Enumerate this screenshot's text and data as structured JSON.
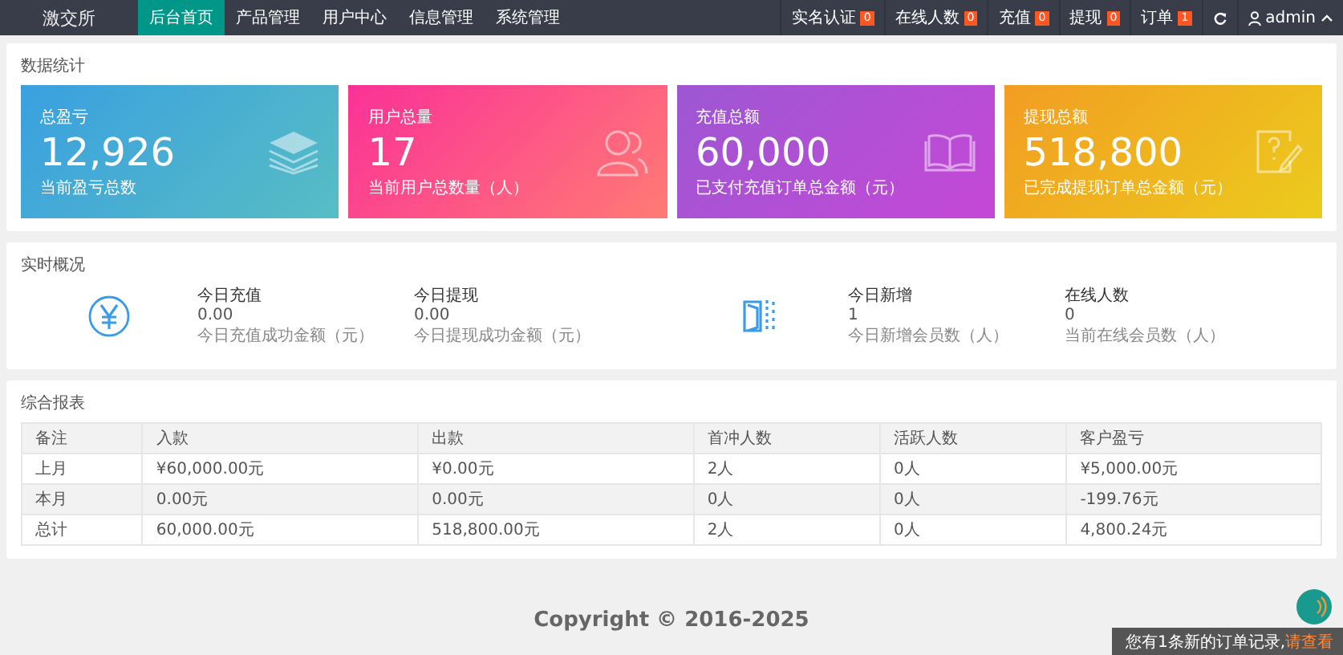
{
  "header": {
    "logo": "激交所",
    "nav": [
      {
        "label": "后台首页",
        "selected": true
      },
      {
        "label": "产品管理",
        "selected": false
      },
      {
        "label": "用户中心",
        "selected": false
      },
      {
        "label": "信息管理",
        "selected": false
      },
      {
        "label": "系统管理",
        "selected": false
      }
    ],
    "counters": [
      {
        "label": "实名认证",
        "count": "0"
      },
      {
        "label": "在线人数",
        "count": "0"
      },
      {
        "label": "充值",
        "count": "0"
      },
      {
        "label": "提现",
        "count": "0"
      },
      {
        "label": "订单",
        "count": "1"
      }
    ],
    "user": "admin"
  },
  "stats": {
    "title": "数据统计",
    "cards": [
      {
        "kind": "layers",
        "title": "总盈亏",
        "value": "12,926",
        "note": "当前盈亏总数"
      },
      {
        "kind": "users",
        "title": "用户总量",
        "value": "17",
        "note": "当前用户总数量（人）"
      },
      {
        "kind": "book",
        "title": "充值总额",
        "value": "60,000",
        "note": "已支付充值订单总金额（元）"
      },
      {
        "kind": "edit",
        "title": "提现总额",
        "value": "518,800",
        "note": "已完成提现订单总金额（元）"
      }
    ]
  },
  "realtime": {
    "title": "实时概况",
    "groups": [
      {
        "kind": "yen",
        "items": [
          {
            "label": "今日充值",
            "value": "0.00",
            "note": "今日充值成功金额（元）"
          },
          {
            "label": "今日提现",
            "value": "0.00",
            "note": "今日提现成功金额（元）"
          }
        ]
      },
      {
        "kind": "door",
        "items": [
          {
            "label": "今日新增",
            "value": "1",
            "note": "今日新增会员数（人）"
          },
          {
            "label": "在线人数",
            "value": "0",
            "note": "当前在线会员数（人）"
          }
        ]
      }
    ]
  },
  "report": {
    "title": "综合报表",
    "columns": [
      "备注",
      "入款",
      "出款",
      "首冲人数",
      "活跃人数",
      "客户盈亏"
    ],
    "rows": [
      [
        "上月",
        "¥60,000.00元",
        "¥0.00元",
        "2人",
        "0人",
        "¥5,000.00元"
      ],
      [
        "本月",
        "0.00元",
        "0.00元",
        "0人",
        "0人",
        "-199.76元"
      ],
      [
        "总计",
        "60,000.00元",
        "518,800.00元",
        "2人",
        "0人",
        "4,800.24元"
      ]
    ]
  },
  "footer": "Copyright © 2016-2025",
  "toast": {
    "message": "您有1条新的订单记录,",
    "link": "请查看"
  }
}
